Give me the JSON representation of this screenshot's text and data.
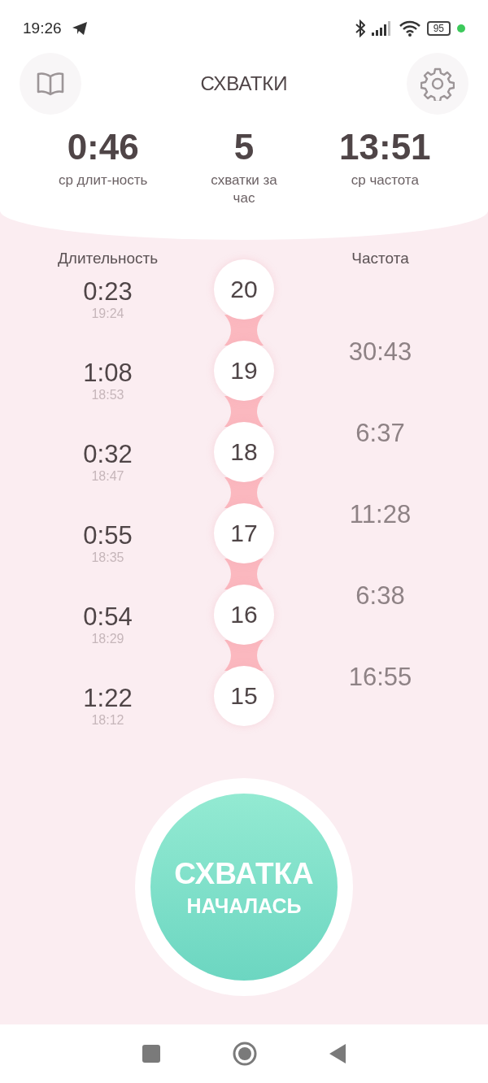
{
  "status_bar": {
    "time": "19:26",
    "battery": "95"
  },
  "header": {
    "title": "СХВАТКИ"
  },
  "stats": [
    {
      "value": "0:46",
      "label": "ср длит-ность"
    },
    {
      "value": "5",
      "label": "схватки за час"
    },
    {
      "value": "13:51",
      "label": "ср частота"
    }
  ],
  "columns": {
    "duration": "Длительность",
    "frequency": "Частота"
  },
  "contractions": [
    {
      "duration": "0:23",
      "time": "19:24",
      "number": "20"
    },
    {
      "duration": "1:08",
      "time": "18:53",
      "number": "19"
    },
    {
      "duration": "0:32",
      "time": "18:47",
      "number": "18"
    },
    {
      "duration": "0:55",
      "time": "18:35",
      "number": "17"
    },
    {
      "duration": "0:54",
      "time": "18:29",
      "number": "16"
    },
    {
      "duration": "1:22",
      "time": "18:12",
      "number": "15"
    }
  ],
  "intervals": [
    "30:43",
    "6:37",
    "11:28",
    "6:38",
    "16:55"
  ],
  "main_button": {
    "line_1": "СХВАТКА",
    "line_2": "НАЧАЛАСЬ"
  }
}
